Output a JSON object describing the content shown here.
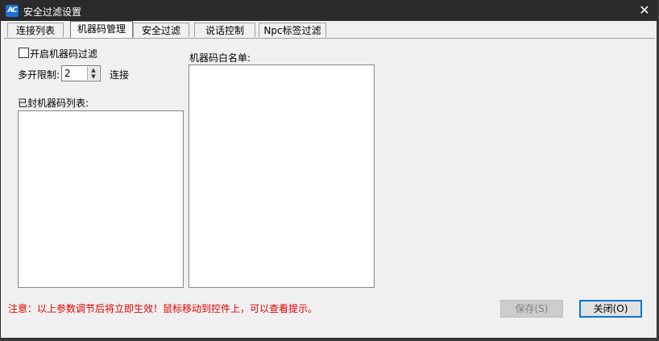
{
  "window": {
    "title": "安全过滤设置",
    "icon_text": "AC",
    "close_glyph": "✕"
  },
  "tabs": [
    {
      "label": "连接列表",
      "active": false
    },
    {
      "label": "机器码管理",
      "active": true
    },
    {
      "label": "安全过滤",
      "active": false
    },
    {
      "label": "说话控制",
      "active": false
    },
    {
      "label": "Npc标签过滤",
      "active": false
    }
  ],
  "machine_code": {
    "enable_filter_label": "开启机器码过滤",
    "enable_filter_checked": false,
    "multi_open_label": "多开限制:",
    "multi_open_value": "2",
    "multi_open_unit": "连接",
    "banned_list_label": "已封机器码列表:",
    "whitelist_label": "机器码白名单:"
  },
  "footer": {
    "notice": "注意：以上参数调节后将立即生效！鼠标移动到控件上，可以查看提示。",
    "save_label": "保存(S)",
    "close_label": "关闭(O)"
  },
  "colors": {
    "titlebar": "#2b2b2b",
    "notice_text": "#e00000",
    "focus_border": "#0078d7"
  },
  "icons": [
    "app-logo-icon",
    "close-icon",
    "spin-up-icon",
    "spin-down-icon"
  ]
}
